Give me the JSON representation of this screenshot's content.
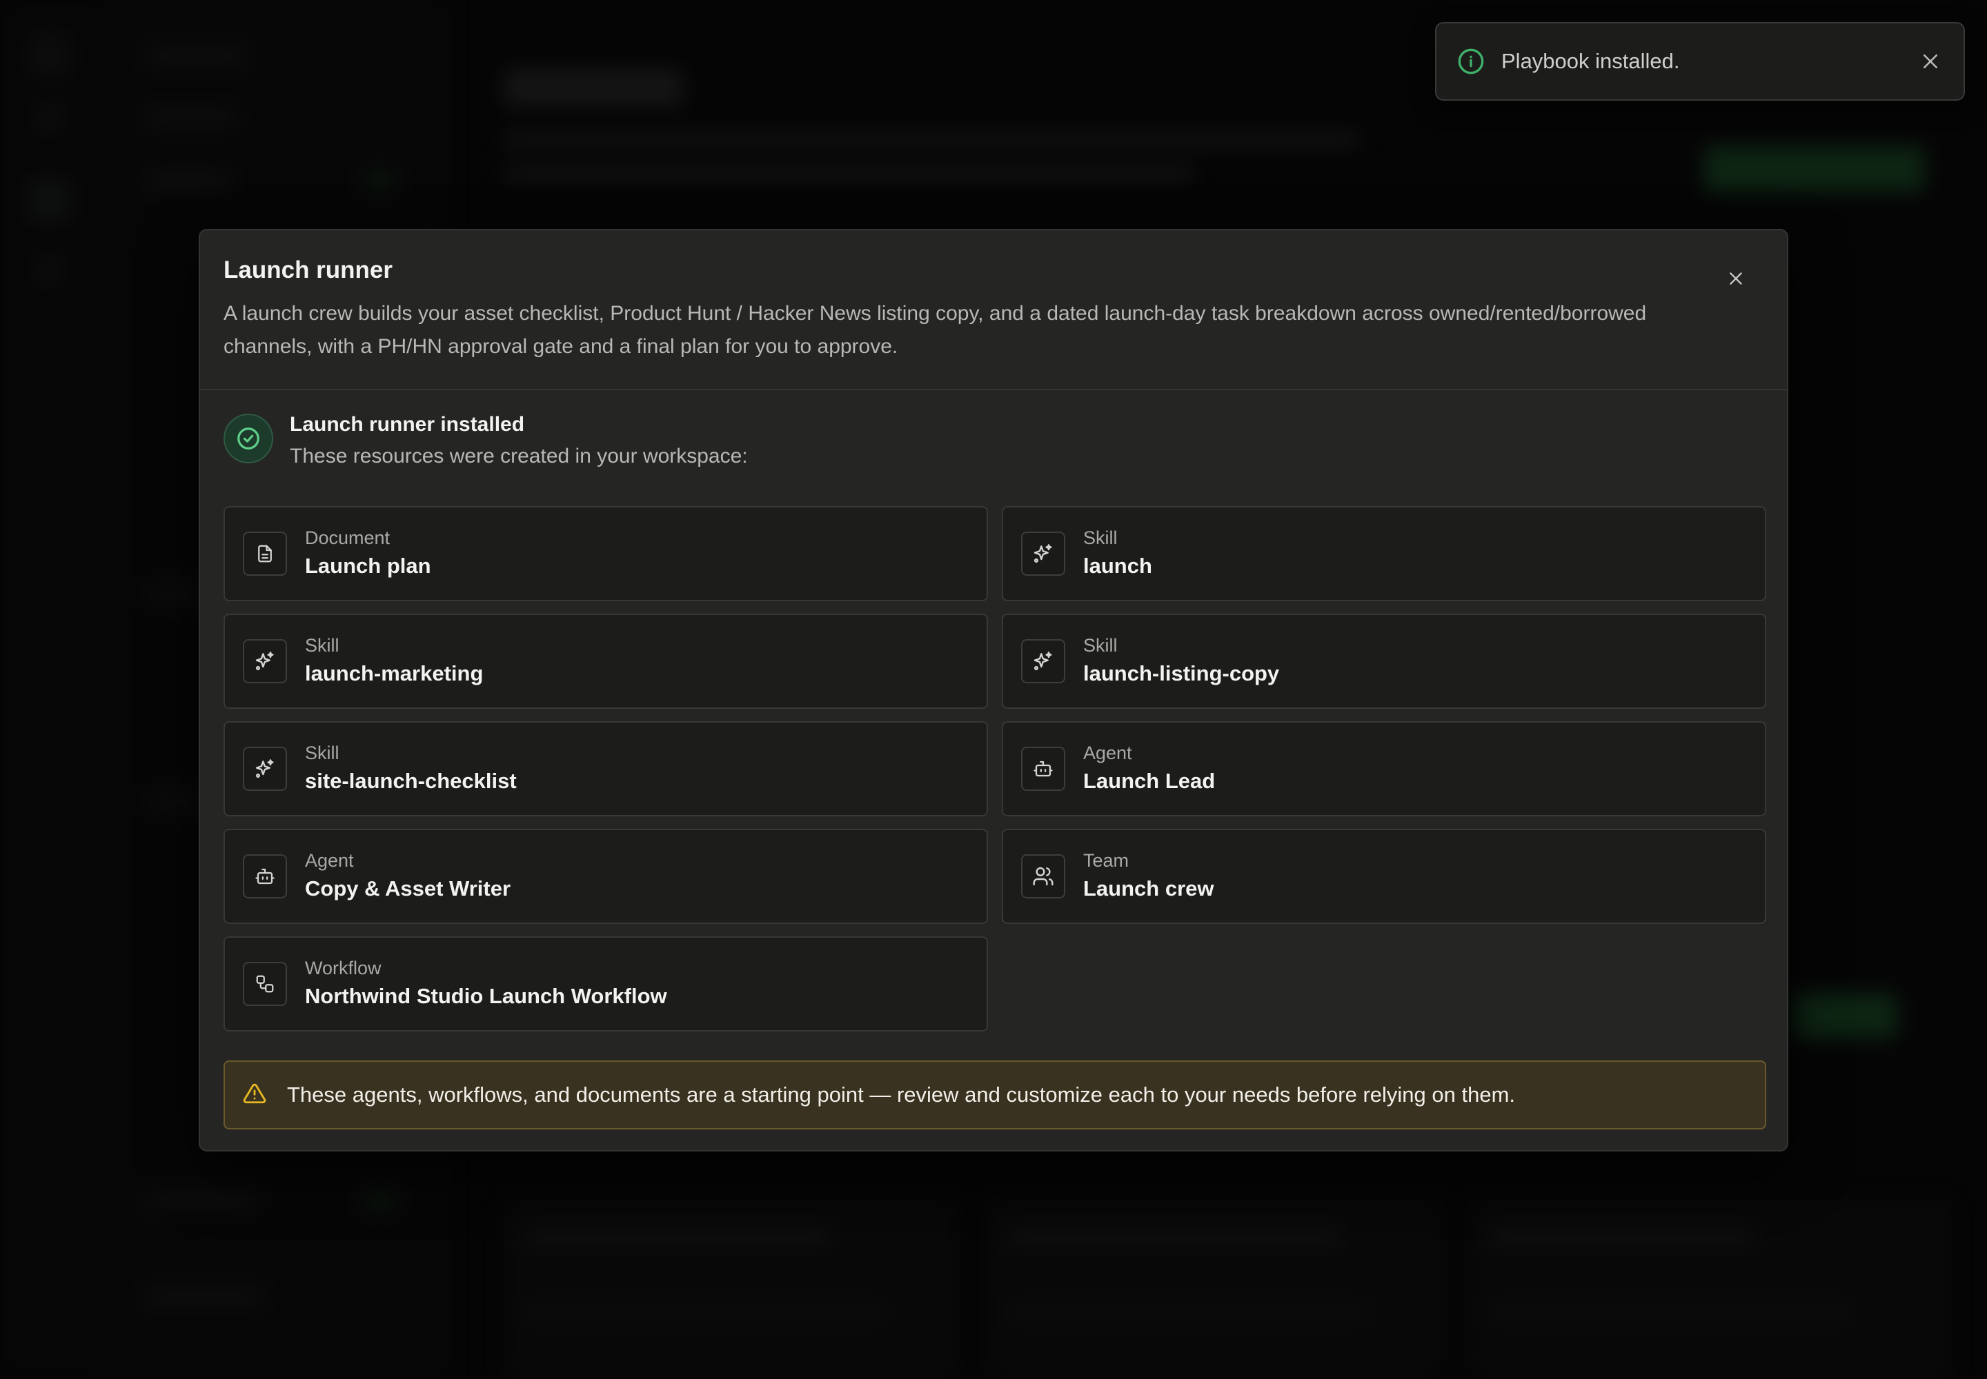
{
  "toast": {
    "message": "Playbook installed.",
    "icon": "info-icon",
    "accent": "#3fb26a"
  },
  "dialog": {
    "title": "Launch runner",
    "description": "A launch crew builds your asset checklist, Product Hunt / Hacker News listing copy, and a dated launch-day task breakdown across owned/rented/borrowed channels, with a PH/HN approval gate and a final plan for you to approve.",
    "installed": {
      "title": "Launch runner installed",
      "subtitle": "These resources were created in your workspace:"
    },
    "resources": [
      {
        "type": "Document",
        "name": "Launch plan",
        "icon": "document-icon"
      },
      {
        "type": "Skill",
        "name": "launch",
        "icon": "sparkles-icon"
      },
      {
        "type": "Skill",
        "name": "launch-marketing",
        "icon": "sparkles-icon"
      },
      {
        "type": "Skill",
        "name": "launch-listing-copy",
        "icon": "sparkles-icon"
      },
      {
        "type": "Skill",
        "name": "site-launch-checklist",
        "icon": "sparkles-icon"
      },
      {
        "type": "Agent",
        "name": "Launch Lead",
        "icon": "bot-icon"
      },
      {
        "type": "Agent",
        "name": "Copy & Asset Writer",
        "icon": "bot-icon"
      },
      {
        "type": "Team",
        "name": "Launch crew",
        "icon": "users-icon"
      },
      {
        "type": "Workflow",
        "name": "Northwind Studio Launch Workflow",
        "icon": "workflow-icon"
      }
    ],
    "warning": "These agents, workflows, and documents are a starting point — review and customize each to your needs before relying on them."
  },
  "colors": {
    "success": "#3fb26a",
    "warning": "#e8b923",
    "warning_bg": "#3a3221"
  }
}
